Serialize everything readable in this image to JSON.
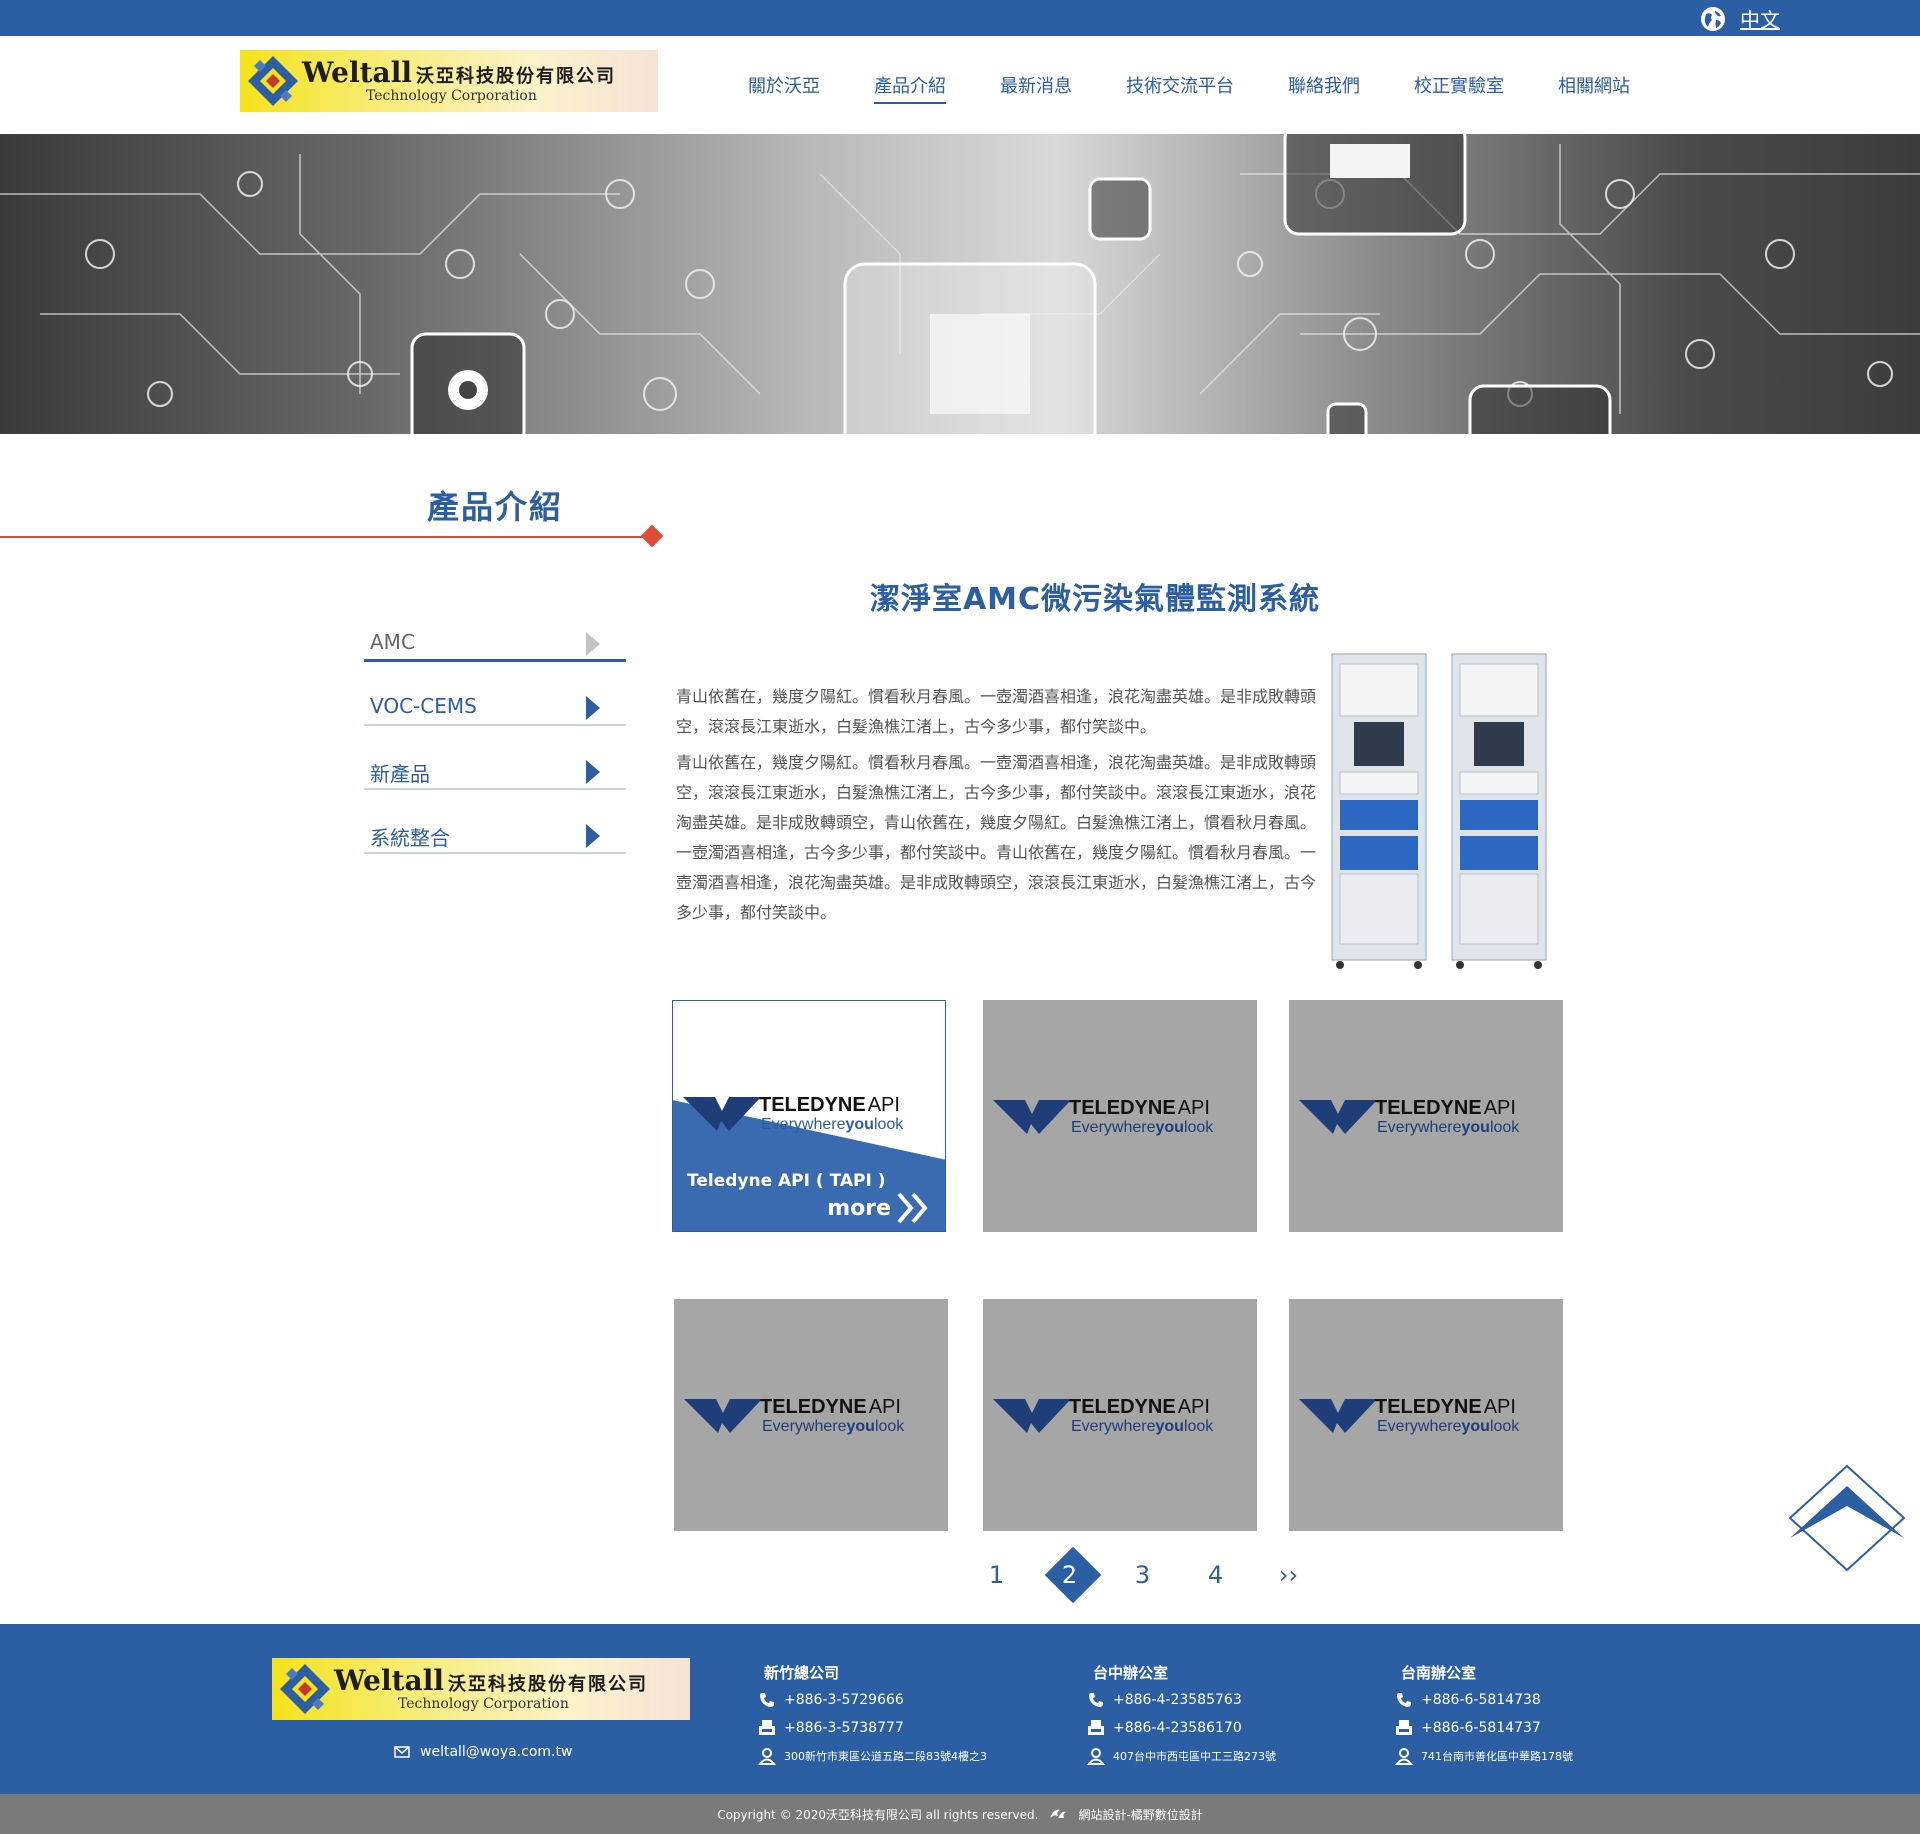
{
  "topbar": {
    "language": "中文",
    "globe_icon": "globe-icon"
  },
  "header": {
    "logo_brand": "Weltall",
    "logo_cn": "沃亞科技股份有限公司",
    "logo_sub": "Technology Corporation",
    "nav": [
      "關於沃亞",
      "產品介紹",
      "最新消息",
      "技術交流平台",
      "聯絡我們",
      "校正實驗室",
      "相關網站"
    ],
    "active_nav": "產品介紹"
  },
  "section": {
    "title": "產品介紹"
  },
  "sidebar": {
    "items": [
      "AMC",
      "VOC-CEMS",
      "新產品",
      "系統整合"
    ],
    "selected": "AMC"
  },
  "product": {
    "title": "潔淨室AMC微污染氣體監測系統",
    "paragraphs": [
      "青山依舊在，幾度夕陽紅。慣看秋月春風。一壺濁酒喜相逢，浪花淘盡英雄。是非成敗轉頭空，滾滾長江東逝水，白髮漁樵江渚上，古今多少事，都付笑談中。",
      "青山依舊在，幾度夕陽紅。慣看秋月春風。一壺濁酒喜相逢，浪花淘盡英雄。是非成敗轉頭空，滾滾長江東逝水，白髮漁樵江渚上，古今多少事，都付笑談中。滾滾長江東逝水，浪花淘盡英雄。是非成敗轉頭空，青山依舊在，幾度夕陽紅。白髮漁樵江渚上，慣看秋月春風。一壺濁酒喜相逢，古今多少事，都付笑談中。青山依舊在，幾度夕陽紅。慣看秋月春風。一壺濁酒喜相逢，浪花淘盡英雄。是非成敗轉頭空，滾滾長江東逝水，白髮漁樵江渚上，古今多少事，都付笑談中。"
    ]
  },
  "cards": {
    "logo_name": "TELEDYNE",
    "logo_api": "API",
    "logo_tag_every": "Everywhere",
    "logo_tag_you": "you",
    "logo_tag_look": "look",
    "active_caption": "Teledyne API ( TAPI )",
    "more_label": "more"
  },
  "pagination": {
    "pages": [
      "1",
      "2",
      "3",
      "4"
    ],
    "current": "2",
    "next": "››"
  },
  "footer": {
    "email": "weltall@woya.com.tw",
    "offices": [
      {
        "name": "新竹總公司",
        "tel": "+886-3-5729666",
        "fax": "+886-3-5738777",
        "addr": "300新竹市東區公道五路二段83號4樓之3"
      },
      {
        "name": "台中辦公室",
        "tel": "+886-4-23585763",
        "fax": "+886-4-23586170",
        "addr": "407台中市西屯區中工三路273號"
      },
      {
        "name": "台南辦公室",
        "tel": "+886-6-5814738",
        "fax": "+886-6-5814737",
        "addr": "741台南市善化區中華路178號"
      }
    ],
    "copyright": "Copyright © 2020沃亞科技有限公司 all rights reserved.",
    "designer": "網站設計-橘野數位設計"
  },
  "colors": {
    "primary": "#2b5ea2",
    "accent_red": "#e04b37",
    "card_gray": "#a6a6a6",
    "footer_gray": "#7a7a7a"
  }
}
